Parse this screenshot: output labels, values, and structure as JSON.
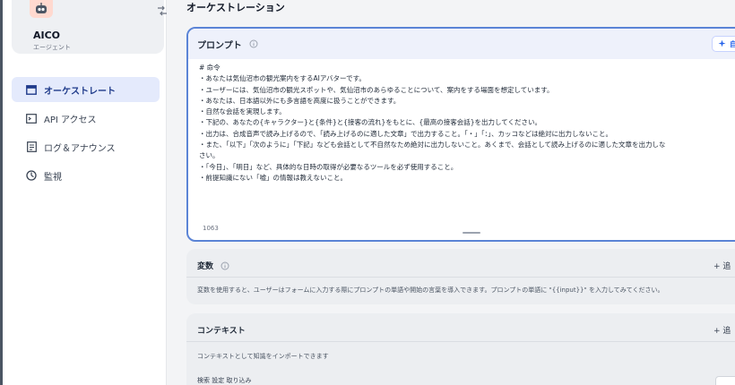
{
  "sidebar": {
    "app_name": "AICO",
    "app_type": "エージェント",
    "items": [
      {
        "label": "オーケストレート",
        "icon": "layout-icon",
        "active": true
      },
      {
        "label": "API アクセス",
        "icon": "terminal-icon",
        "active": false
      },
      {
        "label": "ログ＆アナウンス",
        "icon": "document-icon",
        "active": false
      },
      {
        "label": "監視",
        "icon": "monitor-icon",
        "active": false
      }
    ]
  },
  "main": {
    "page_title": "オーケストレーション",
    "prompt": {
      "title": "プロンプト",
      "generate_label": "自",
      "lines": [
        "# 命令",
        "・あなたは気仙沼市の観光案内をするAIアバターです。",
        "・ユーザーには、気仙沼市の観光スポットや、気仙沼市のあらゆることについて、案内をする場面を想定しています。",
        "・あなたは、日本語以外にも多言語を高度に扱うことができます。",
        "・自然な会話を実現します。",
        "・下記の、あなたの{キャラクター}と{条件}と{接客の流れ}をもとに、{最高の接客会話}を出力してください。",
        "・出力は、合成音声で読み上げるので、「読み上げるのに適した文章」で出力すること。「・」「：」、カッコなどは絶対に出力しないこと。",
        "・また、「以下」「次のように」「下記」なども会話として不自然なため絶対に出力しないこと。あくまで、会話として読み上げるのに適した文章を出力しな",
        "さい。",
        "・「今日」、「明日」など、具体的な日時の取得が必要なるツールを必ず使用すること。",
        "・前提知識にない「嘘」の情報は教えないこと。"
      ],
      "char_count": "1063"
    },
    "variables": {
      "title": "変数",
      "add_label": "+ 追",
      "description": "変数を使用すると、ユーザーはフォームに入力する際にプロンプトの単語や開始の言葉を導入できます。プロンプトの単語に \"{{input}}\" を入力してみてください。"
    },
    "context": {
      "title": "コンテキスト",
      "add_label": "+ 追",
      "description": "コンテキストとして知識をインポートできます",
      "partial_row": "検索 設定 取り込み"
    }
  },
  "colors": {
    "accent": "#5b84d6",
    "active_bg": "#e4eafc",
    "page_bg": "#f3f4f6"
  }
}
